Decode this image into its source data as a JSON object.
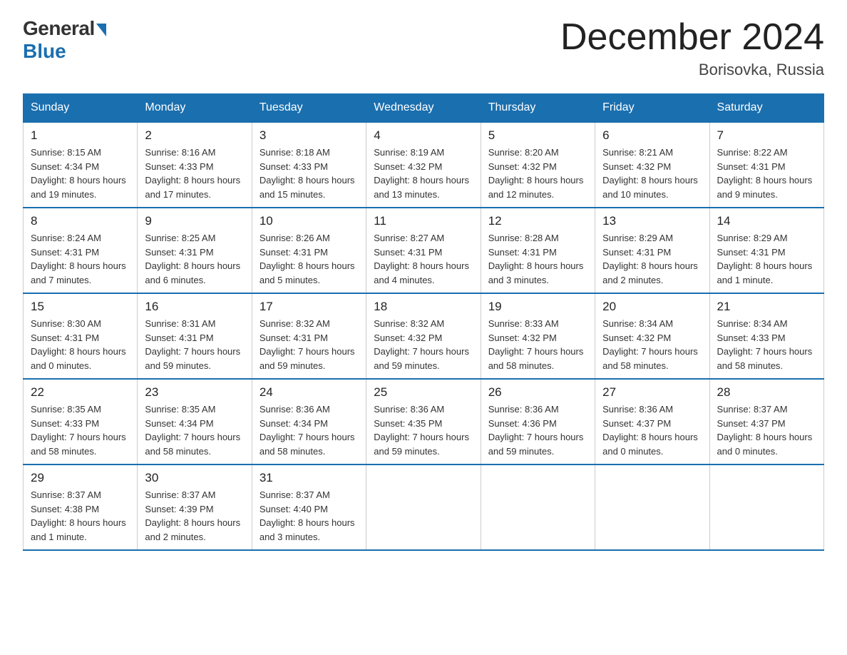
{
  "logo": {
    "general": "General",
    "blue": "Blue"
  },
  "header": {
    "title": "December 2024",
    "location": "Borisovka, Russia"
  },
  "weekdays": [
    "Sunday",
    "Monday",
    "Tuesday",
    "Wednesday",
    "Thursday",
    "Friday",
    "Saturday"
  ],
  "weeks": [
    [
      {
        "day": "1",
        "sunrise": "8:15 AM",
        "sunset": "4:34 PM",
        "daylight": "8 hours and 19 minutes."
      },
      {
        "day": "2",
        "sunrise": "8:16 AM",
        "sunset": "4:33 PM",
        "daylight": "8 hours and 17 minutes."
      },
      {
        "day": "3",
        "sunrise": "8:18 AM",
        "sunset": "4:33 PM",
        "daylight": "8 hours and 15 minutes."
      },
      {
        "day": "4",
        "sunrise": "8:19 AM",
        "sunset": "4:32 PM",
        "daylight": "8 hours and 13 minutes."
      },
      {
        "day": "5",
        "sunrise": "8:20 AM",
        "sunset": "4:32 PM",
        "daylight": "8 hours and 12 minutes."
      },
      {
        "day": "6",
        "sunrise": "8:21 AM",
        "sunset": "4:32 PM",
        "daylight": "8 hours and 10 minutes."
      },
      {
        "day": "7",
        "sunrise": "8:22 AM",
        "sunset": "4:31 PM",
        "daylight": "8 hours and 9 minutes."
      }
    ],
    [
      {
        "day": "8",
        "sunrise": "8:24 AM",
        "sunset": "4:31 PM",
        "daylight": "8 hours and 7 minutes."
      },
      {
        "day": "9",
        "sunrise": "8:25 AM",
        "sunset": "4:31 PM",
        "daylight": "8 hours and 6 minutes."
      },
      {
        "day": "10",
        "sunrise": "8:26 AM",
        "sunset": "4:31 PM",
        "daylight": "8 hours and 5 minutes."
      },
      {
        "day": "11",
        "sunrise": "8:27 AM",
        "sunset": "4:31 PM",
        "daylight": "8 hours and 4 minutes."
      },
      {
        "day": "12",
        "sunrise": "8:28 AM",
        "sunset": "4:31 PM",
        "daylight": "8 hours and 3 minutes."
      },
      {
        "day": "13",
        "sunrise": "8:29 AM",
        "sunset": "4:31 PM",
        "daylight": "8 hours and 2 minutes."
      },
      {
        "day": "14",
        "sunrise": "8:29 AM",
        "sunset": "4:31 PM",
        "daylight": "8 hours and 1 minute."
      }
    ],
    [
      {
        "day": "15",
        "sunrise": "8:30 AM",
        "sunset": "4:31 PM",
        "daylight": "8 hours and 0 minutes."
      },
      {
        "day": "16",
        "sunrise": "8:31 AM",
        "sunset": "4:31 PM",
        "daylight": "7 hours and 59 minutes."
      },
      {
        "day": "17",
        "sunrise": "8:32 AM",
        "sunset": "4:31 PM",
        "daylight": "7 hours and 59 minutes."
      },
      {
        "day": "18",
        "sunrise": "8:32 AM",
        "sunset": "4:32 PM",
        "daylight": "7 hours and 59 minutes."
      },
      {
        "day": "19",
        "sunrise": "8:33 AM",
        "sunset": "4:32 PM",
        "daylight": "7 hours and 58 minutes."
      },
      {
        "day": "20",
        "sunrise": "8:34 AM",
        "sunset": "4:32 PM",
        "daylight": "7 hours and 58 minutes."
      },
      {
        "day": "21",
        "sunrise": "8:34 AM",
        "sunset": "4:33 PM",
        "daylight": "7 hours and 58 minutes."
      }
    ],
    [
      {
        "day": "22",
        "sunrise": "8:35 AM",
        "sunset": "4:33 PM",
        "daylight": "7 hours and 58 minutes."
      },
      {
        "day": "23",
        "sunrise": "8:35 AM",
        "sunset": "4:34 PM",
        "daylight": "7 hours and 58 minutes."
      },
      {
        "day": "24",
        "sunrise": "8:36 AM",
        "sunset": "4:34 PM",
        "daylight": "7 hours and 58 minutes."
      },
      {
        "day": "25",
        "sunrise": "8:36 AM",
        "sunset": "4:35 PM",
        "daylight": "7 hours and 59 minutes."
      },
      {
        "day": "26",
        "sunrise": "8:36 AM",
        "sunset": "4:36 PM",
        "daylight": "7 hours and 59 minutes."
      },
      {
        "day": "27",
        "sunrise": "8:36 AM",
        "sunset": "4:37 PM",
        "daylight": "8 hours and 0 minutes."
      },
      {
        "day": "28",
        "sunrise": "8:37 AM",
        "sunset": "4:37 PM",
        "daylight": "8 hours and 0 minutes."
      }
    ],
    [
      {
        "day": "29",
        "sunrise": "8:37 AM",
        "sunset": "4:38 PM",
        "daylight": "8 hours and 1 minute."
      },
      {
        "day": "30",
        "sunrise": "8:37 AM",
        "sunset": "4:39 PM",
        "daylight": "8 hours and 2 minutes."
      },
      {
        "day": "31",
        "sunrise": "8:37 AM",
        "sunset": "4:40 PM",
        "daylight": "8 hours and 3 minutes."
      },
      null,
      null,
      null,
      null
    ]
  ]
}
